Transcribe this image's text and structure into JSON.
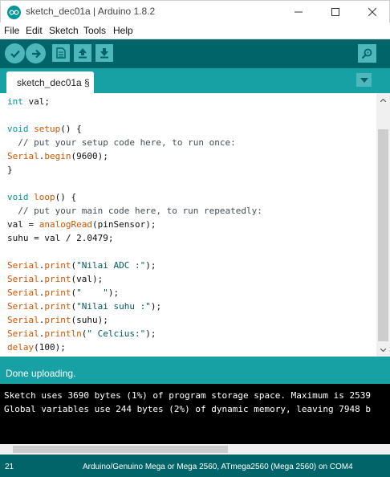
{
  "window": {
    "title": "sketch_dec01a | Arduino 1.8.2"
  },
  "menu": [
    "File",
    "Edit",
    "Sketch",
    "Tools",
    "Help"
  ],
  "toolbar": {
    "buttons": [
      "verify-icon",
      "upload-icon",
      "new-icon",
      "open-icon",
      "save-icon",
      "serial-monitor-icon"
    ]
  },
  "tab": {
    "label": "sketch_dec01a §"
  },
  "code": {
    "lines": [
      [
        {
          "t": "int",
          "c": "kw-type"
        },
        {
          "t": " val;"
        }
      ],
      [],
      [
        {
          "t": "void",
          "c": "kw-type"
        },
        {
          "t": " "
        },
        {
          "t": "setup",
          "c": "kw-obj"
        },
        {
          "t": "() {"
        }
      ],
      [
        {
          "t": "  // put your setup code here, to run once:",
          "c": "comment"
        }
      ],
      [
        {
          "t": "Serial",
          "c": "kw-obj"
        },
        {
          "t": "."
        },
        {
          "t": "begin",
          "c": "kw-obj"
        },
        {
          "t": "(9600);"
        }
      ],
      [
        {
          "t": "}"
        }
      ],
      [],
      [
        {
          "t": "void",
          "c": "kw-type"
        },
        {
          "t": " "
        },
        {
          "t": "loop",
          "c": "kw-obj"
        },
        {
          "t": "() {"
        }
      ],
      [
        {
          "t": "  // put your main code here, to run repeatedly:",
          "c": "comment"
        }
      ],
      [
        {
          "t": "val = "
        },
        {
          "t": "analogRead",
          "c": "kw-obj"
        },
        {
          "t": "(pinSensor);"
        }
      ],
      [
        {
          "t": "suhu = val / 2.0479;"
        }
      ],
      [],
      [
        {
          "t": "Serial",
          "c": "kw-obj"
        },
        {
          "t": "."
        },
        {
          "t": "print",
          "c": "kw-obj"
        },
        {
          "t": "("
        },
        {
          "t": "\"Nilai ADC :\"",
          "c": "str"
        },
        {
          "t": ");"
        }
      ],
      [
        {
          "t": "Serial",
          "c": "kw-obj"
        },
        {
          "t": "."
        },
        {
          "t": "print",
          "c": "kw-obj"
        },
        {
          "t": "(val);"
        }
      ],
      [
        {
          "t": "Serial",
          "c": "kw-obj"
        },
        {
          "t": "."
        },
        {
          "t": "print",
          "c": "kw-obj"
        },
        {
          "t": "("
        },
        {
          "t": "\"    \"",
          "c": "str"
        },
        {
          "t": ");"
        }
      ],
      [
        {
          "t": "Serial",
          "c": "kw-obj"
        },
        {
          "t": "."
        },
        {
          "t": "print",
          "c": "kw-obj"
        },
        {
          "t": "("
        },
        {
          "t": "\"Nilai suhu :\"",
          "c": "str"
        },
        {
          "t": ");"
        }
      ],
      [
        {
          "t": "Serial",
          "c": "kw-obj"
        },
        {
          "t": "."
        },
        {
          "t": "print",
          "c": "kw-obj"
        },
        {
          "t": "(suhu);"
        }
      ],
      [
        {
          "t": "Serial",
          "c": "kw-obj"
        },
        {
          "t": "."
        },
        {
          "t": "println",
          "c": "kw-obj"
        },
        {
          "t": "("
        },
        {
          "t": "\" Celcius:\"",
          "c": "str"
        },
        {
          "t": ");"
        }
      ],
      [
        {
          "t": "delay",
          "c": "kw-obj"
        },
        {
          "t": "(100);"
        }
      ]
    ]
  },
  "status": {
    "message": "Done uploading."
  },
  "console": {
    "lines": [
      "Sketch uses 3690 bytes (1%) of program storage space. Maximum is 2539",
      "Global variables use 244 bytes (2%) of dynamic memory, leaving 7948 b"
    ]
  },
  "footer": {
    "line_number": "21",
    "board": "Arduino/Genuino Mega or Mega 2560, ATmega2560 (Mega 2560) on COM4"
  },
  "colors": {
    "toolbar": "#006468",
    "tabbar": "#17a1a5",
    "button": "#4db7bb",
    "keyword_type": "#00979c",
    "keyword_function": "#d35400"
  }
}
